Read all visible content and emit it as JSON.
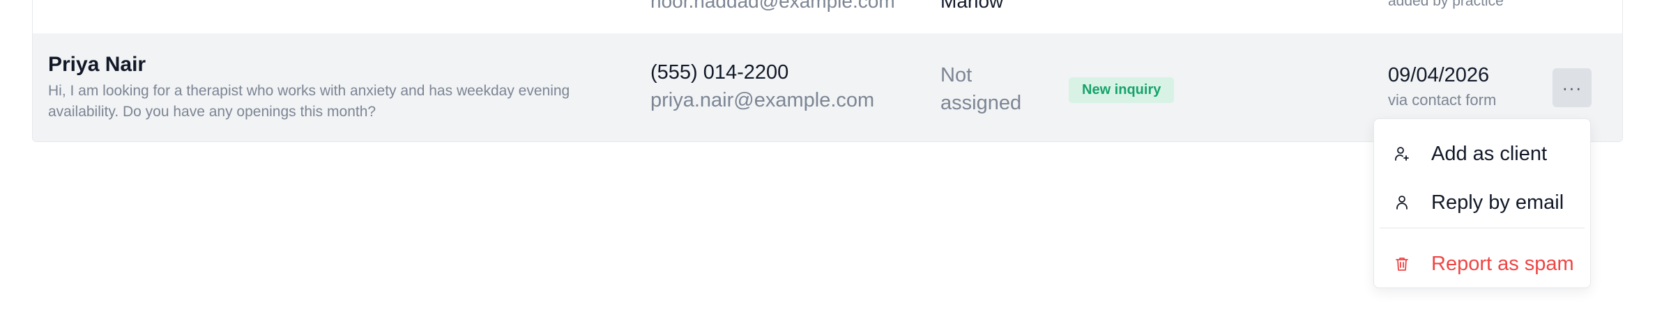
{
  "row_above": {
    "email": "noor.haddad@example.com",
    "clinician": "Marlow",
    "source": "added by practice"
  },
  "inquiry": {
    "name": "Priya Nair",
    "message": "Hi, I am looking for a therapist who works with anxiety and has weekday evening availability. Do you have any openings this month?",
    "phone": "(555) 014-2200",
    "email": "priya.nair@example.com",
    "assigned": "Not assigned",
    "status": "New inquiry",
    "date": "09/04/2026",
    "source": "via contact form",
    "more_label": "···"
  },
  "menu": {
    "items": [
      {
        "label": "Add as client",
        "icon": "user-plus-icon"
      },
      {
        "label": "Reply by email",
        "icon": "user-icon"
      },
      {
        "label": "Report as spam",
        "icon": "trash-icon"
      }
    ]
  },
  "colors": {
    "row_bg": "#f1f3f5",
    "badge_bg": "#d9f2e6",
    "badge_text": "#16a36a",
    "danger": "#ef4444",
    "muted": "#7c8593"
  }
}
